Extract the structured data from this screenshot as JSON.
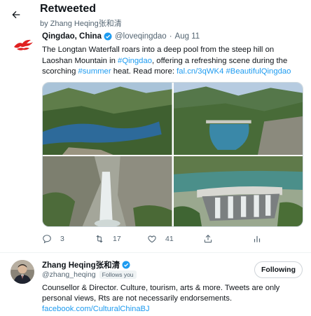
{
  "header": {
    "title": "Retweeted",
    "subtitle": "by Zhang Heqing张和清"
  },
  "tweet": {
    "author_name": "Qingdao, China",
    "author_handle": "@loveqingdao",
    "separator": "·",
    "date": "Aug 11",
    "text_parts": {
      "p1": "The Longtan Waterfall roars into a deep pool from the steep hill on Laoshan Mountain in ",
      "hashtag1": "#Qingdao",
      "p2": ", offering a refreshing scene during the scorching ",
      "hashtag2": "#summer",
      "p3": " heat. Read more: ",
      "link": "fal.cn/3qWK4",
      "p4": " ",
      "hashtag3": "#BeautifulQingdao"
    },
    "media_icons": [
      "reservoir-photo",
      "dam-lake-photo",
      "waterfall-photo",
      "dam-spillway-photo"
    ],
    "actions": {
      "replies": "3",
      "retweets": "17",
      "likes": "41"
    }
  },
  "profile": {
    "name": "Zhang Heqing张和清",
    "handle": "@zhang_heqing",
    "follows_badge": "Follows you",
    "follow_button": "Following",
    "bio": "Counsellor & Director. Culture, tourism, arts & more. Tweets are only personal views, Rts are not necessarily endorsements.",
    "bio_link": "facebook.com/CulturalChinaBJ"
  },
  "colors": {
    "accent": "#1d9bf0",
    "text": "#0f1419",
    "secondary": "#536471",
    "logo_red": "#e02020"
  }
}
